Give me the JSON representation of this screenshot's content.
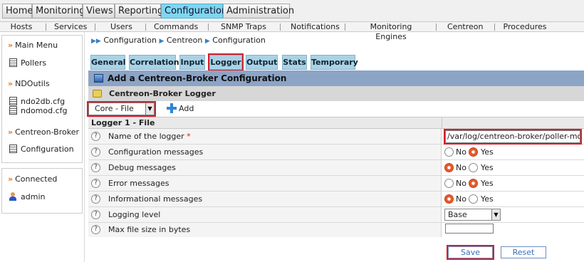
{
  "top_nav": {
    "items": [
      "Home",
      "Monitoring",
      "Views",
      "Reporting",
      "Configuration",
      "Administration"
    ],
    "active": "Configuration"
  },
  "sub_nav": {
    "items": [
      "Hosts",
      "Services",
      "Users",
      "Commands",
      "SNMP Traps",
      "Notifications",
      "Monitoring Engines",
      "Centreon",
      "Procedures"
    ]
  },
  "breadcrumb": [
    "Configuration",
    "Centreon",
    "Configuration"
  ],
  "sidebar": {
    "main_menu": "Main Menu",
    "pollers": "Pollers",
    "ndoutils": "NDOutils",
    "ndo2db": "ndo2db.cfg",
    "ndomod": "ndomod.cfg",
    "centreon_broker": "Centreon-Broker",
    "configuration": "Configuration",
    "connected": "Connected",
    "user": "admin"
  },
  "tabs": [
    "General",
    "Correlation",
    "Input",
    "Logger",
    "Output",
    "Stats",
    "Temporary"
  ],
  "active_tab": "Logger",
  "panel": {
    "title": "Add a Centreon-Broker Configuration",
    "section": "Centreon-Broker Logger",
    "type_select": "Core - File",
    "add_label": "Add",
    "table_header": "Logger 1 - File"
  },
  "rows": [
    {
      "label": "Name of the logger",
      "required": "*",
      "value": "/var/log/centreon-broker/poller-module.log"
    },
    {
      "label": "Configuration messages",
      "no": "No",
      "yes": "Yes",
      "selected": "Yes"
    },
    {
      "label": "Debug messages",
      "no": "No",
      "yes": "Yes",
      "selected": "No"
    },
    {
      "label": "Error messages",
      "no": "No",
      "yes": "Yes",
      "selected": "Yes"
    },
    {
      "label": "Informational messages",
      "no": "No",
      "yes": "Yes",
      "selected": "No"
    },
    {
      "label": "Logging level",
      "value": "Base"
    },
    {
      "label": "Max file size in bytes",
      "value": ""
    }
  ],
  "buttons": {
    "save": "Save",
    "reset": "Reset"
  },
  "help_glyph": "?",
  "colors": {
    "accent": "#7fd6f0",
    "tab": "#a9d3e5",
    "panel_header": "#8ca4c6",
    "highlight": "#d3202f",
    "radio_on": "#e85a2d"
  }
}
